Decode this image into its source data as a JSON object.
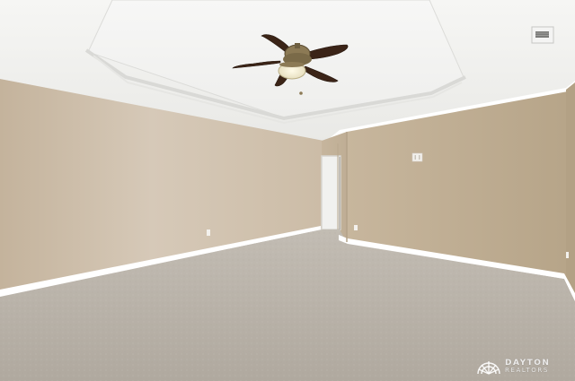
{
  "photo": {
    "subject": "empty-bedroom",
    "palette": {
      "ceiling": "#f3f3f1",
      "wall_left": "#c8b7a0",
      "wall_back": "#c3b39b",
      "wall_right": "#bcab91",
      "carpet": "#b9b2a8",
      "trim": "#ffffff",
      "fan_blade": "#3b2417",
      "fan_metal": "#8c7a55"
    }
  },
  "watermark": {
    "brand": "DAYTON",
    "sub": "REALTORS"
  }
}
